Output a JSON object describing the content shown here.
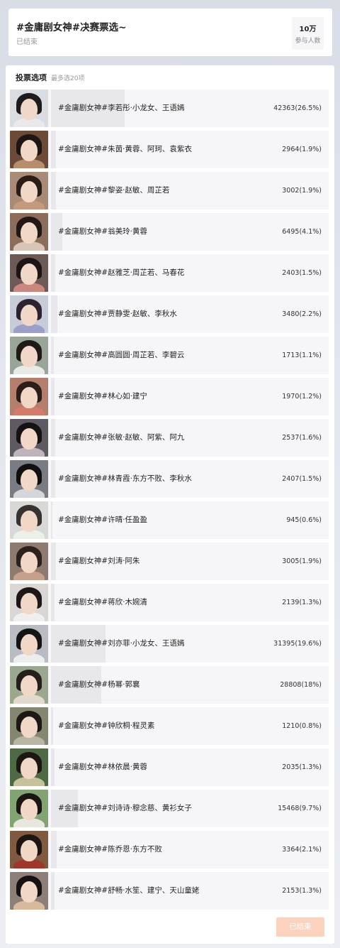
{
  "poll": {
    "title": "#金庸剧女神#决赛票选~",
    "status": "已结束",
    "participants": "10万",
    "participants_label": "参与人数"
  },
  "options_header": {
    "title": "投票选项",
    "hint": "最多选20项"
  },
  "options": [
    {
      "label": "#金庸剧女神#李若彤·小龙女、王语嫣",
      "count": "42363(26.5%)",
      "percent": 26.5,
      "colors": [
        "#d9dde2",
        "#1d1b1d",
        "#e9e9ec"
      ]
    },
    {
      "label": "#金庸剧女神#朱茵·黄蓉、阿珂、袁紫衣",
      "count": "2964(1.9%)",
      "percent": 1.9,
      "colors": [
        "#6b4a38",
        "#1e1614",
        "#b98c6e"
      ]
    },
    {
      "label": "#金庸剧女神#黎姿·赵敏、周芷若",
      "count": "3002(1.9%)",
      "percent": 1.9,
      "colors": [
        "#a88a76",
        "#2a1c17",
        "#c49a7f"
      ]
    },
    {
      "label": "#金庸剧女神#翁美玲·黄蓉",
      "count": "6495(4.1%)",
      "percent": 4.1,
      "colors": [
        "#8c6d5c",
        "#211717",
        "#d9c4b7"
      ]
    },
    {
      "label": "#金庸剧女神#赵雅芝·周芷若、马春花",
      "count": "2403(1.5%)",
      "percent": 1.5,
      "colors": [
        "#6e5a55",
        "#1d1515",
        "#c9877d"
      ]
    },
    {
      "label": "#金庸剧女神#贾静雯·赵敏、李秋水",
      "count": "3480(2.2%)",
      "percent": 2.2,
      "colors": [
        "#c8cbd8",
        "#2b2430",
        "#9aa0c8"
      ]
    },
    {
      "label": "#金庸剧女神#高圆圆·周芷若、李碧云",
      "count": "1713(1.1%)",
      "percent": 1.1,
      "colors": [
        "#9aa59a",
        "#1d1a18",
        "#e8eae6"
      ]
    },
    {
      "label": "#金庸剧女神#林心如·建宁",
      "count": "1970(1.2%)",
      "percent": 1.2,
      "colors": [
        "#b37f6c",
        "#2a1d1a",
        "#d47b6a"
      ]
    },
    {
      "label": "#金庸剧女神#张敏·赵敏、阿紫、阿九",
      "count": "2537(1.6%)",
      "percent": 1.6,
      "colors": [
        "#5f5a62",
        "#151214",
        "#bdb4bd"
      ]
    },
    {
      "label": "#金庸剧女神#林青霞·东方不败、李秋水",
      "count": "2407(1.5%)",
      "percent": 1.5,
      "colors": [
        "#7a7c83",
        "#101012",
        "#d5d6db"
      ]
    },
    {
      "label": "#金庸剧女神#许晴·任盈盈",
      "count": "945(0.6%)",
      "percent": 0.6,
      "colors": [
        "#d8d9d6",
        "#373232",
        "#eeeeea"
      ]
    },
    {
      "label": "#金庸剧女神#刘涛·阿朱",
      "count": "3005(1.9%)",
      "percent": 1.9,
      "colors": [
        "#8f7a70",
        "#2b211d",
        "#c7a08b"
      ]
    },
    {
      "label": "#金庸剧女神#蒋欣·木婉清",
      "count": "2139(1.3%)",
      "percent": 1.3,
      "colors": [
        "#d9d6d4",
        "#1d1719",
        "#efefef"
      ]
    },
    {
      "label": "#金庸剧女神#刘亦菲·小龙女、王语嫣",
      "count": "31395(19.6%)",
      "percent": 19.6,
      "colors": [
        "#b9bcc2",
        "#151414",
        "#ecedee"
      ]
    },
    {
      "label": "#金庸剧女神#杨幂·郭襄",
      "count": "28808(18%)",
      "percent": 18.0,
      "colors": [
        "#9ca78f",
        "#23201c",
        "#e2d9cf"
      ]
    },
    {
      "label": "#金庸剧女神#钟欣桐·程灵素",
      "count": "1210(0.8%)",
      "percent": 0.8,
      "colors": [
        "#85866f",
        "#1c1816",
        "#b7b6a4"
      ]
    },
    {
      "label": "#金庸剧女神#林依晨·黄蓉",
      "count": "2035(1.3%)",
      "percent": 1.3,
      "colors": [
        "#4e6a45",
        "#1d1714",
        "#c6c39c"
      ]
    },
    {
      "label": "#金庸剧女神#刘诗诗·穆念慈、黄衫女子",
      "count": "15468(9.7%)",
      "percent": 9.7,
      "colors": [
        "#82a472",
        "#1a1614",
        "#e7e7e0"
      ]
    },
    {
      "label": "#金庸剧女神#陈乔恩·东方不败",
      "count": "3364(2.1%)",
      "percent": 2.1,
      "colors": [
        "#7f5a40",
        "#1e1412",
        "#a2352a"
      ]
    },
    {
      "label": "#金庸剧女神#舒畅·水笙、建宁、天山童姥",
      "count": "2153(1.3%)",
      "percent": 1.3,
      "colors": [
        "#8c7f77",
        "#161213",
        "#d9b99c"
      ]
    }
  ],
  "footer": {
    "done_label": "已结束"
  }
}
